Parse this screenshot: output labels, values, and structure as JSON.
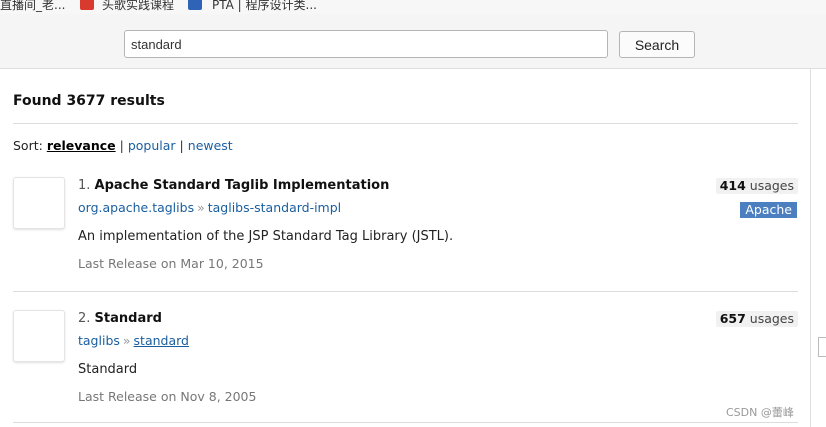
{
  "bookmarks": [
    {
      "label": "直播间_老...",
      "icon": "folder-icon",
      "color": "#f7f7f7"
    },
    {
      "label": "头歌实践课程",
      "icon": "educoder-icon",
      "color": "#d93a2e"
    },
    {
      "label": "PTA | 程序设计类...",
      "icon": "pta-icon",
      "color": "#2e63b8"
    }
  ],
  "search": {
    "value": "standard",
    "button_label": "Search"
  },
  "results_summary": "Found 3677 results",
  "sort": {
    "label": "Sort:",
    "options": [
      "relevance",
      "popular",
      "newest"
    ],
    "selected": "relevance",
    "separator": "|"
  },
  "results": [
    {
      "index": "1.",
      "name": "Apache Standard Taglib Implementation",
      "group": "org.apache.taglibs",
      "artifact": "taglibs-standard-impl",
      "description": "An implementation of the JSP Standard Tag Library (JSTL).",
      "last_release": "Last Release on Mar 10, 2015",
      "usages_count": "414",
      "usages_label": "usages",
      "license": "Apache"
    },
    {
      "index": "2.",
      "name": "Standard",
      "group": "taglibs",
      "artifact": "standard",
      "description": "Standard",
      "last_release": "Last Release on Nov 8, 2005",
      "usages_count": "657",
      "usages_label": "usages"
    }
  ],
  "path_separator": "»",
  "watermark": "CSDN @蕾峰",
  "colors": {
    "link": "#1a5e9e",
    "license_badge": "#4b7fbf",
    "header_bg": "#f5f5f5"
  }
}
